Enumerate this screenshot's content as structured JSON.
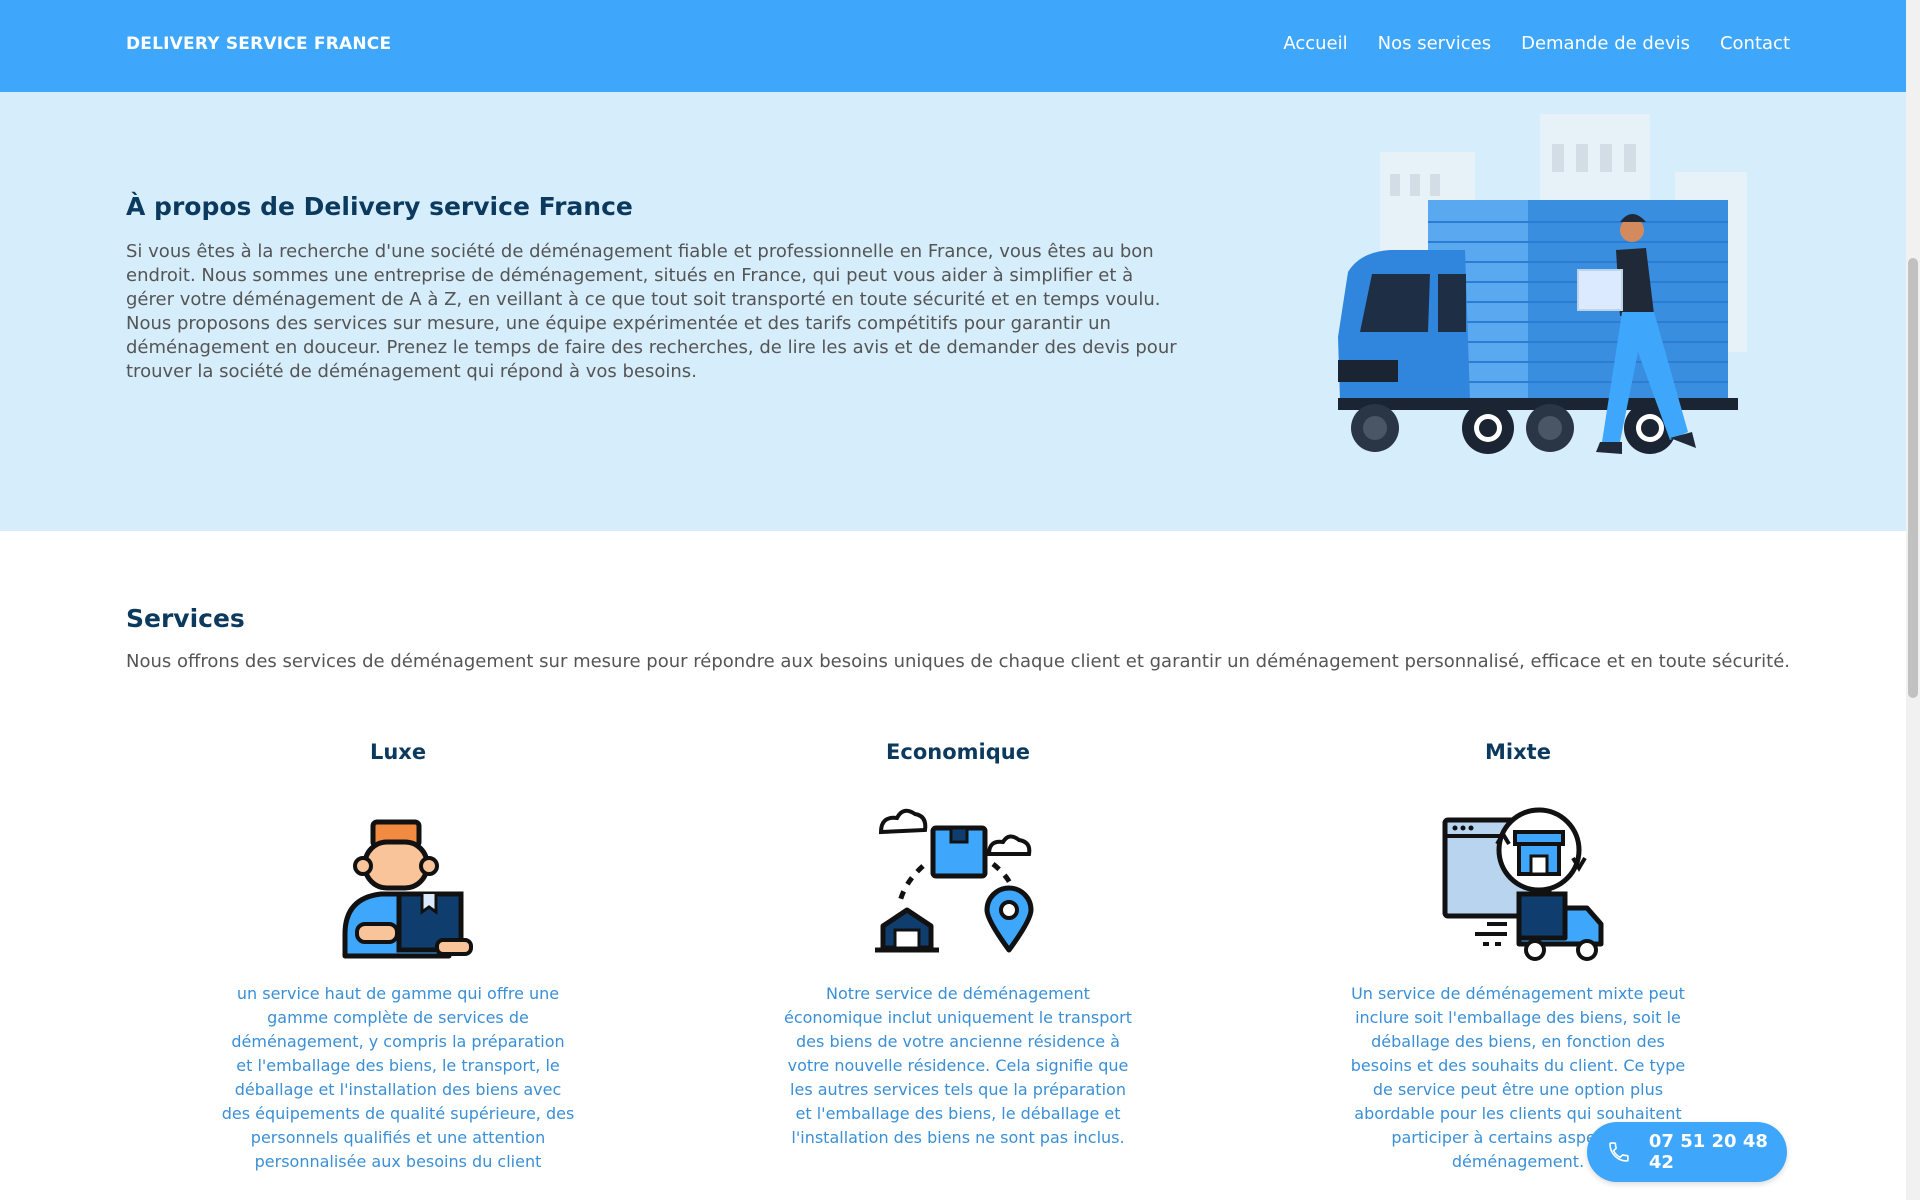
{
  "header": {
    "brand": "DELIVERY SERVICE FRANCE",
    "nav": [
      "Accueil",
      "Nos services",
      "Demande de devis",
      "Contact"
    ]
  },
  "about": {
    "title": "À propos de Delivery service France",
    "text": "Si vous êtes à la recherche d'une société de déménagement fiable et professionnelle en France, vous êtes au bon endroit. Nous sommes une entreprise de déménagement, situés en France, qui peut vous aider à simplifier et à gérer votre déménagement de A à Z, en veillant à ce que tout soit transporté en toute sécurité et en temps voulu. Nous proposons des services sur mesure, une équipe expérimentée et des tarifs compétitifs pour garantir un déménagement en douceur. Prenez le temps de faire des recherches, de lire les avis et de demander des devis pour trouver la société de déménagement qui répond à vos besoins."
  },
  "services": {
    "title": "Services",
    "intro": "Nous offrons des services de déménagement sur mesure pour répondre aux besoins uniques de chaque client et garantir un déménagement personnalisé, efficace et en toute sécurité.",
    "items": [
      {
        "title": "Luxe",
        "icon": "mover-with-box-icon",
        "text": "un service haut de gamme qui offre une gamme complète de services de déménagement, y compris la préparation et l'emballage des biens, le transport, le déballage et l'installation des biens avec des équipements de qualité supérieure, des personnels qualifiés et une attention personnalisée aux besoins du client"
      },
      {
        "title": "Economique",
        "icon": "delivery-route-icon",
        "text": "Notre service de déménagement économique inclut uniquement le transport des biens de votre ancienne résidence à votre nouvelle résidence. Cela signifie que les autres services tels que la préparation et l'emballage des biens, le déballage et l'installation des biens ne sont pas inclus."
      },
      {
        "title": "Mixte",
        "icon": "online-store-delivery-icon",
        "text": "Un service de déménagement mixte peut inclure soit l'emballage des biens, soit le déballage des biens, en fonction des besoins et des souhaits du client. Ce type de service peut être une option plus abordable pour les clients qui souhaitent participer à certains aspects du déménagement."
      }
    ]
  },
  "phone": {
    "number": "07 51 20 48 42",
    "icon": "phone-icon"
  },
  "colors": {
    "primary": "#3ea6fb",
    "heading": "#0c3a5e",
    "about_bg": "#d6edfb",
    "card_text": "#3a8fd6"
  }
}
